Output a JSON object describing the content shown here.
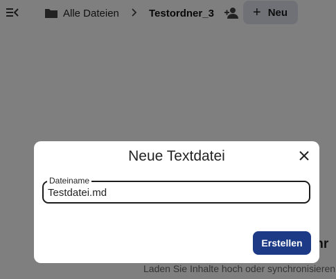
{
  "header": {
    "menu_icon": "menu-collapse-icon",
    "breadcrumb": {
      "home_icon": "folder-icon",
      "home_label": "Alle Dateien",
      "separator_icon": "chevron-right-icon",
      "current_label": "Testordner_3"
    },
    "share_icon": "person-add-icon",
    "new_button": {
      "icon": "plus",
      "label": "Neu"
    }
  },
  "background": {
    "empty_title": "Ihr",
    "empty_description": "Laden Sie Inhalte hoch oder synchronisieren"
  },
  "dialog": {
    "title": "Neue Textdatei",
    "close_icon": "close-icon",
    "field": {
      "label": "Dateiname",
      "value": "Testdatei.md"
    },
    "submit_label": "Erstellen"
  },
  "colors": {
    "primary_button": "#1c3a86",
    "new_button_bg": "#dfe3ec",
    "overlay": "rgba(0,0,0,0.5)"
  }
}
